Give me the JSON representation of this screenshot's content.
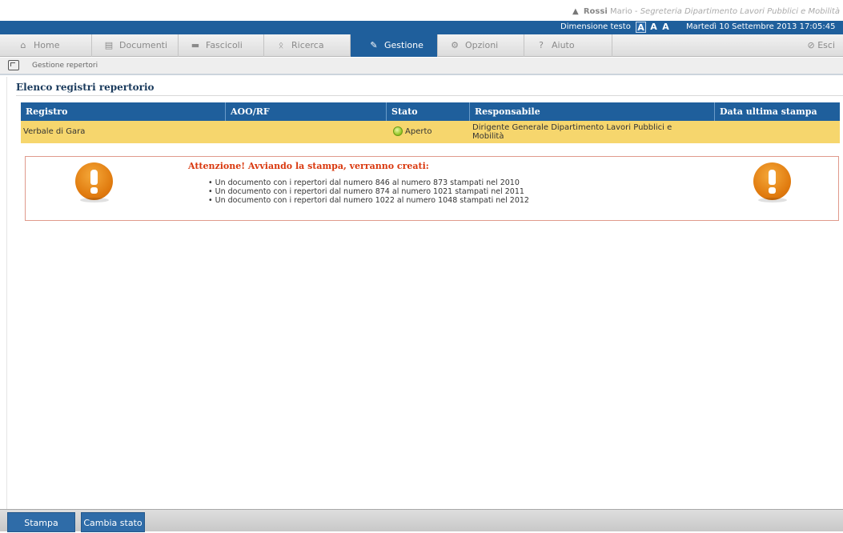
{
  "header": {
    "user_name": "Rossi",
    "user_rest": "Mario -",
    "user_office": "Segreteria Dipartimento Lavori Pubblici e Mobilità",
    "text_size_label": "Dimensione testo",
    "text_size_options": [
      "A",
      "A",
      "A"
    ],
    "datetime": "Martedì 10 Settembre 2013 17:05:45"
  },
  "nav": {
    "tabs": [
      {
        "label": "Home",
        "icon": "⌂"
      },
      {
        "label": "Documenti",
        "icon": "▤"
      },
      {
        "label": "Fascicoli",
        "icon": "▬"
      },
      {
        "label": "Ricerca",
        "icon": "ᛟ"
      },
      {
        "label": "Gestione",
        "icon": "✎"
      },
      {
        "label": "Opzioni",
        "icon": "⚙"
      },
      {
        "label": "Aiuto",
        "icon": "?"
      }
    ],
    "logout": "⊘ Esci"
  },
  "breadcrumb": {
    "text": "Gestione repertori"
  },
  "main": {
    "title": "Elenco registri repertorio",
    "columns": [
      "Registro",
      "AOO/RF",
      "Stato",
      "Responsabile",
      "Data ultima stampa"
    ],
    "rows": [
      {
        "registro": "Verbale di Gara",
        "aoo": "",
        "stato": "Aperto",
        "responsabile": "Dirigente Generale Dipartimento Lavori Pubblici e Mobilità",
        "data": ""
      }
    ]
  },
  "alert": {
    "title": "Attenzione! Avviando la stampa, verranno creati:",
    "items": [
      "• Un documento con i repertori dal numero 846 al numero 873 stampati nel 2010",
      "• Un documento con i repertori dal numero 874 al numero 1021 stampati nel 2011",
      "• Un documento con i repertori dal numero 1022 al numero 1048 stampati nel 2012"
    ]
  },
  "footer": {
    "buttons": [
      "Stampa",
      "Cambia stato"
    ]
  },
  "colors": {
    "primary": "#1f5f9c",
    "row_highlight": "#f6d66d",
    "warning": "#e07a0e",
    "alert_text": "#d9380e"
  }
}
